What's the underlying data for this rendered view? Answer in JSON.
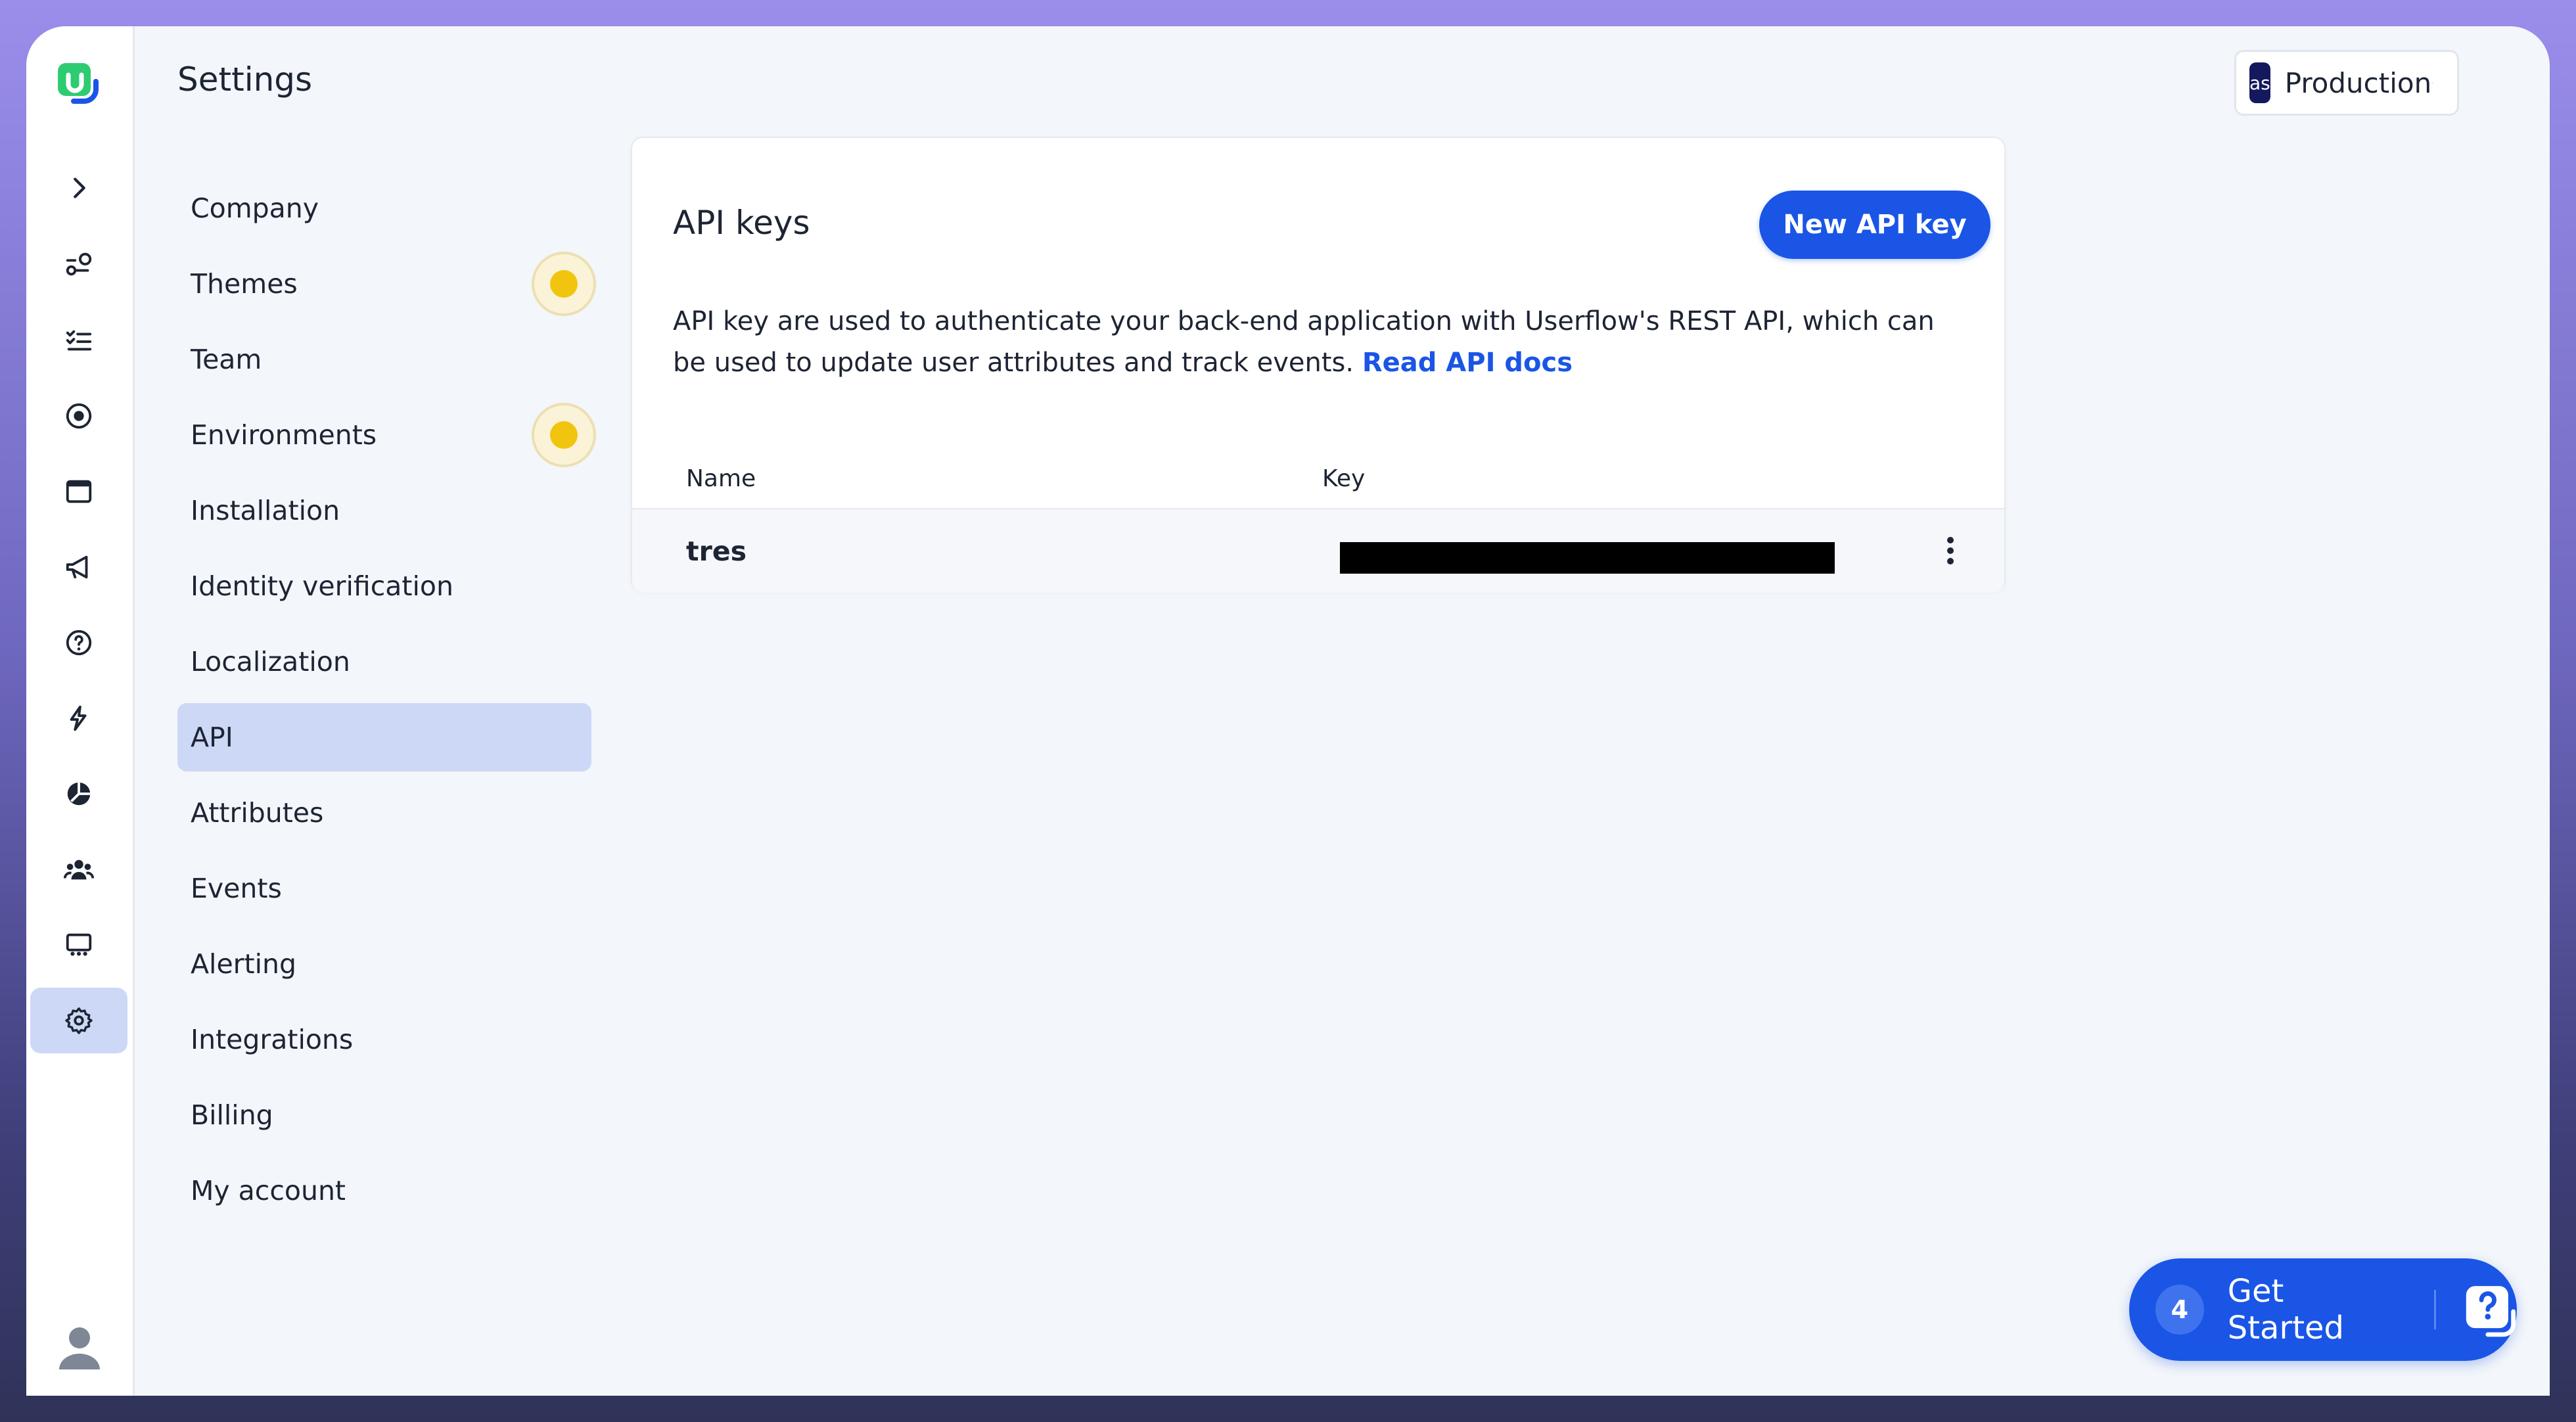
{
  "header": {
    "title": "Settings"
  },
  "environment": {
    "badge": "as",
    "label": "Production"
  },
  "rail": {
    "items": [
      {
        "icon": "chevron-right-icon"
      },
      {
        "icon": "flows-icon"
      },
      {
        "icon": "checklist-icon"
      },
      {
        "icon": "target-icon"
      },
      {
        "icon": "window-icon"
      },
      {
        "icon": "megaphone-icon"
      },
      {
        "icon": "help-icon"
      },
      {
        "icon": "bolt-icon"
      },
      {
        "icon": "analytics-icon"
      },
      {
        "icon": "users-icon"
      },
      {
        "icon": "companies-icon"
      },
      {
        "icon": "gear-icon",
        "active": true
      }
    ]
  },
  "nav": {
    "items": [
      {
        "label": "Company"
      },
      {
        "label": "Themes",
        "beacon": true
      },
      {
        "label": "Team"
      },
      {
        "label": "Environments",
        "beacon": true
      },
      {
        "label": "Installation"
      },
      {
        "label": "Identity verification"
      },
      {
        "label": "Localization"
      },
      {
        "label": "API",
        "active": true
      },
      {
        "label": "Attributes"
      },
      {
        "label": "Events"
      },
      {
        "label": "Alerting"
      },
      {
        "label": "Integrations"
      },
      {
        "label": "Billing"
      },
      {
        "label": "My account"
      }
    ]
  },
  "api_card": {
    "title": "API keys",
    "new_button": "New API key",
    "description": "API key are used to authenticate your back-end application with Userflow's REST API, which can be used to update user attributes and track events.",
    "docs_link": "Read API docs",
    "columns": [
      "Name",
      "Key"
    ],
    "rows": [
      {
        "name": "tres",
        "key_redacted": true
      }
    ]
  },
  "get_started": {
    "count": "4",
    "label": "Get Started"
  },
  "colors": {
    "accent": "#1a55e6",
    "active_bg": "#cdd8f6",
    "beacon": "#f1c40f",
    "env_badge": "#14195e"
  }
}
